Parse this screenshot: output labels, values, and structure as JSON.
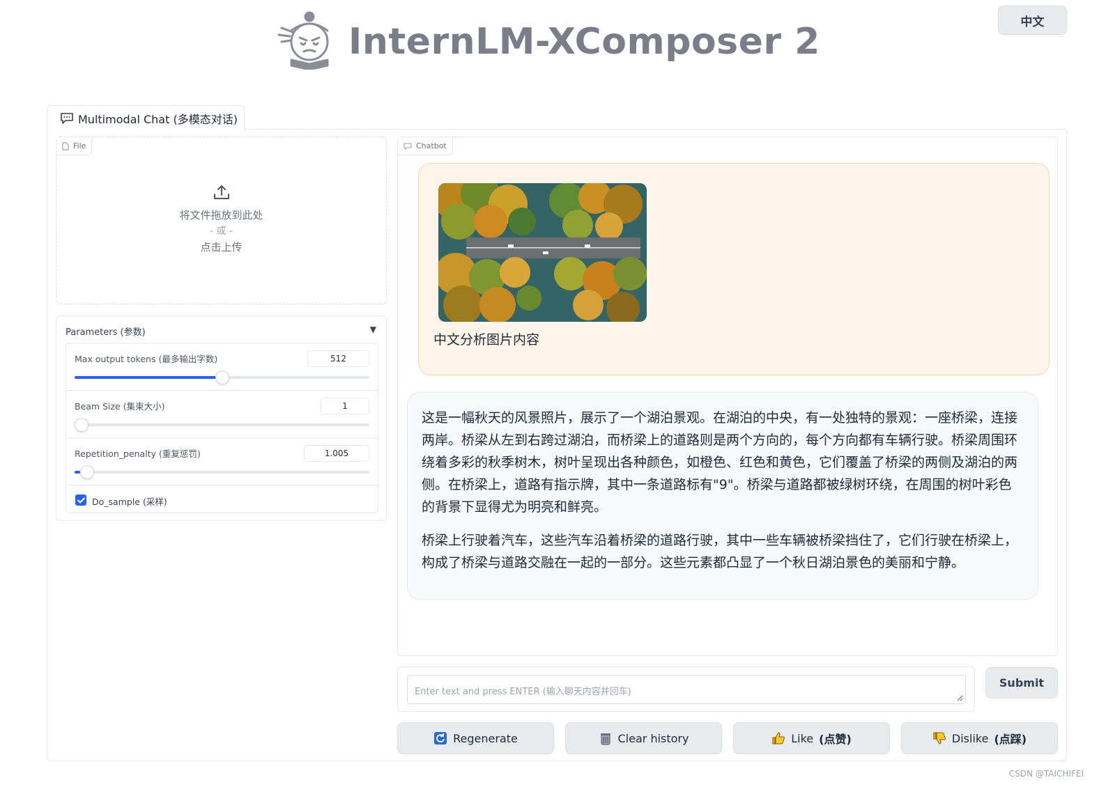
{
  "header": {
    "title": "InternLM-XComposer 2",
    "lang_button": "中文"
  },
  "tabs": [
    {
      "label": "Multimodal Chat (多模态对话)",
      "icon": "chat-icon",
      "active": true
    }
  ],
  "file_upload": {
    "label": "File",
    "drop_text": "将文件拖放到此处",
    "or_text": "- 或 -",
    "click_text": "点击上传"
  },
  "parameters": {
    "title": "Parameters (参数)",
    "max_tokens": {
      "label": "Max output tokens (最多输出字数)",
      "value": "512",
      "fraction": 0.5
    },
    "beam_size": {
      "label": "Beam Size (集束大小)",
      "value": "1",
      "fraction": 0.0
    },
    "repetition_penalty": {
      "label": "Repetition_penalty (重复惩罚)",
      "value": "1.005",
      "fraction": 0.02
    },
    "do_sample": {
      "label": "Do_sample (采样)",
      "checked": true
    }
  },
  "chatbot": {
    "label": "Chatbot",
    "user_message": "中文分析图片内容",
    "bot_message": [
      "这是一幅秋天的风景照片，展示了一个湖泊景观。在湖泊的中央，有一处独特的景观：一座桥梁，连接两岸。桥梁从左到右跨过湖泊，而桥梁上的道路则是两个方向的，每个方向都有车辆行驶。桥梁周围环绕着多彩的秋季树木，树叶呈现出各种颜色，如橙色、红色和黄色，它们覆盖了桥梁的两侧及湖泊的两侧。在桥梁上，道路有指示牌，其中一条道路标有\"9\"。桥梁与道路都被绿树环绕，在周围的树叶彩色的背景下显得尤为明亮和鲜亮。",
      "桥梁上行驶着汽车，这些汽车沿着桥梁的道路行驶，其中一些车辆被桥梁挡住了，它们行驶在桥梁上，构成了桥梁与道路交融在一起的一部分。这些元素都凸显了一个秋日湖泊景色的美丽和宁静。"
    ]
  },
  "input": {
    "placeholder": "Enter text and press ENTER (输入聊天内容并回车)",
    "submit_label": "Submit"
  },
  "actions": {
    "regenerate": "Regenerate",
    "clear_history": "Clear history",
    "like": "Like",
    "like_cn": "(点赞)",
    "dislike": "Dislike",
    "dislike_cn": "(点踩)"
  },
  "watermark": "CSDN @TAICHIFEI",
  "colors": {
    "accent": "#2563eb",
    "user_bubble": "#fdf5ea",
    "user_bubble_border": "#f8d5a8",
    "bot_bubble": "#f7f8fa",
    "title_gray": "#7b7e8a"
  }
}
